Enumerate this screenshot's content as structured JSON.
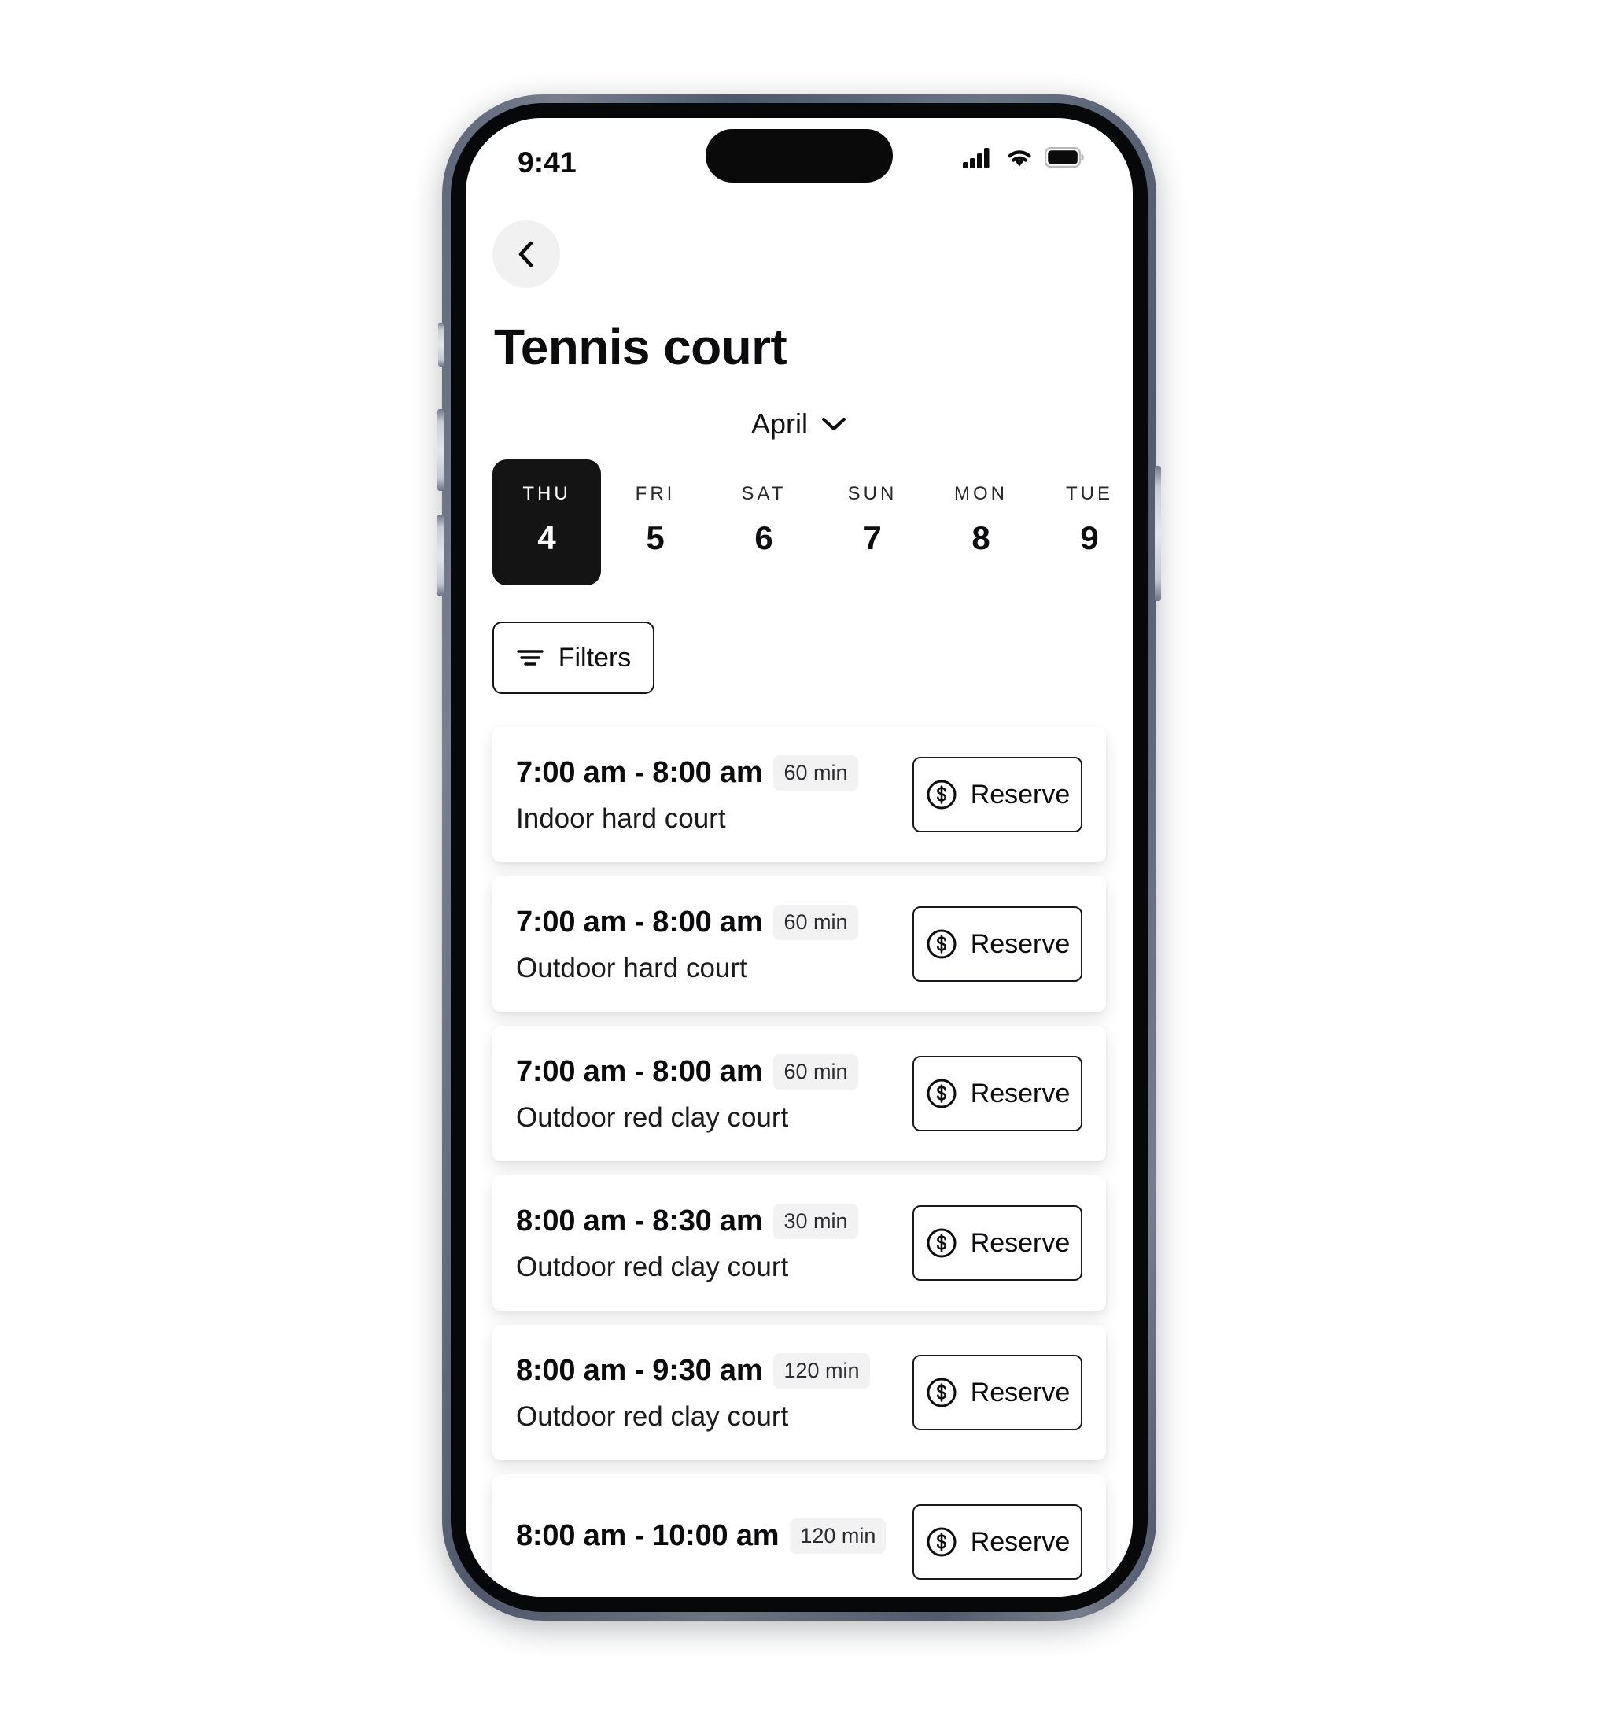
{
  "status_bar": {
    "time": "9:41",
    "cellular_icon": "cellular-bars-icon",
    "wifi_icon": "wifi-icon",
    "battery_icon": "battery-full-icon"
  },
  "header": {
    "back_icon": "chevron-left-icon",
    "title": "Tennis court"
  },
  "month_selector": {
    "label": "April",
    "chevron_icon": "chevron-down-icon"
  },
  "dates": [
    {
      "dow": "THU",
      "day": "4",
      "selected": true
    },
    {
      "dow": "FRI",
      "day": "5",
      "selected": false
    },
    {
      "dow": "SAT",
      "day": "6",
      "selected": false
    },
    {
      "dow": "SUN",
      "day": "7",
      "selected": false
    },
    {
      "dow": "MON",
      "day": "8",
      "selected": false
    },
    {
      "dow": "TUE",
      "day": "9",
      "selected": false
    }
  ],
  "filters": {
    "label": "Filters",
    "icon": "filter-lines-icon"
  },
  "slots": [
    {
      "time": "7:00 am - 8:00 am",
      "duration": "60 min",
      "court": "Indoor hard court",
      "action": "Reserve",
      "action_icon": "dollar-circle-icon"
    },
    {
      "time": "7:00 am - 8:00 am",
      "duration": "60 min",
      "court": "Outdoor hard court",
      "action": "Reserve",
      "action_icon": "dollar-circle-icon"
    },
    {
      "time": "7:00 am - 8:00 am",
      "duration": "60 min",
      "court": "Outdoor red clay court",
      "action": "Reserve",
      "action_icon": "dollar-circle-icon"
    },
    {
      "time": "8:00 am - 8:30 am",
      "duration": "30 min",
      "court": "Outdoor red clay court",
      "action": "Reserve",
      "action_icon": "dollar-circle-icon"
    },
    {
      "time": "8:00 am - 9:30 am",
      "duration": "120 min",
      "court": "Outdoor red clay court",
      "action": "Reserve",
      "action_icon": "dollar-circle-icon"
    },
    {
      "time": "8:00 am - 10:00 am",
      "duration": "120 min",
      "court": "",
      "action": "Reserve",
      "action_icon": "dollar-circle-icon"
    }
  ],
  "colors": {
    "accent": "#141414",
    "page_bg": "#ffffff",
    "card_bg": "#ffffff",
    "badge_bg": "#f2f2f3",
    "back_btn_bg": "#f1f1f1",
    "frame_rail": "#5c6576"
  }
}
